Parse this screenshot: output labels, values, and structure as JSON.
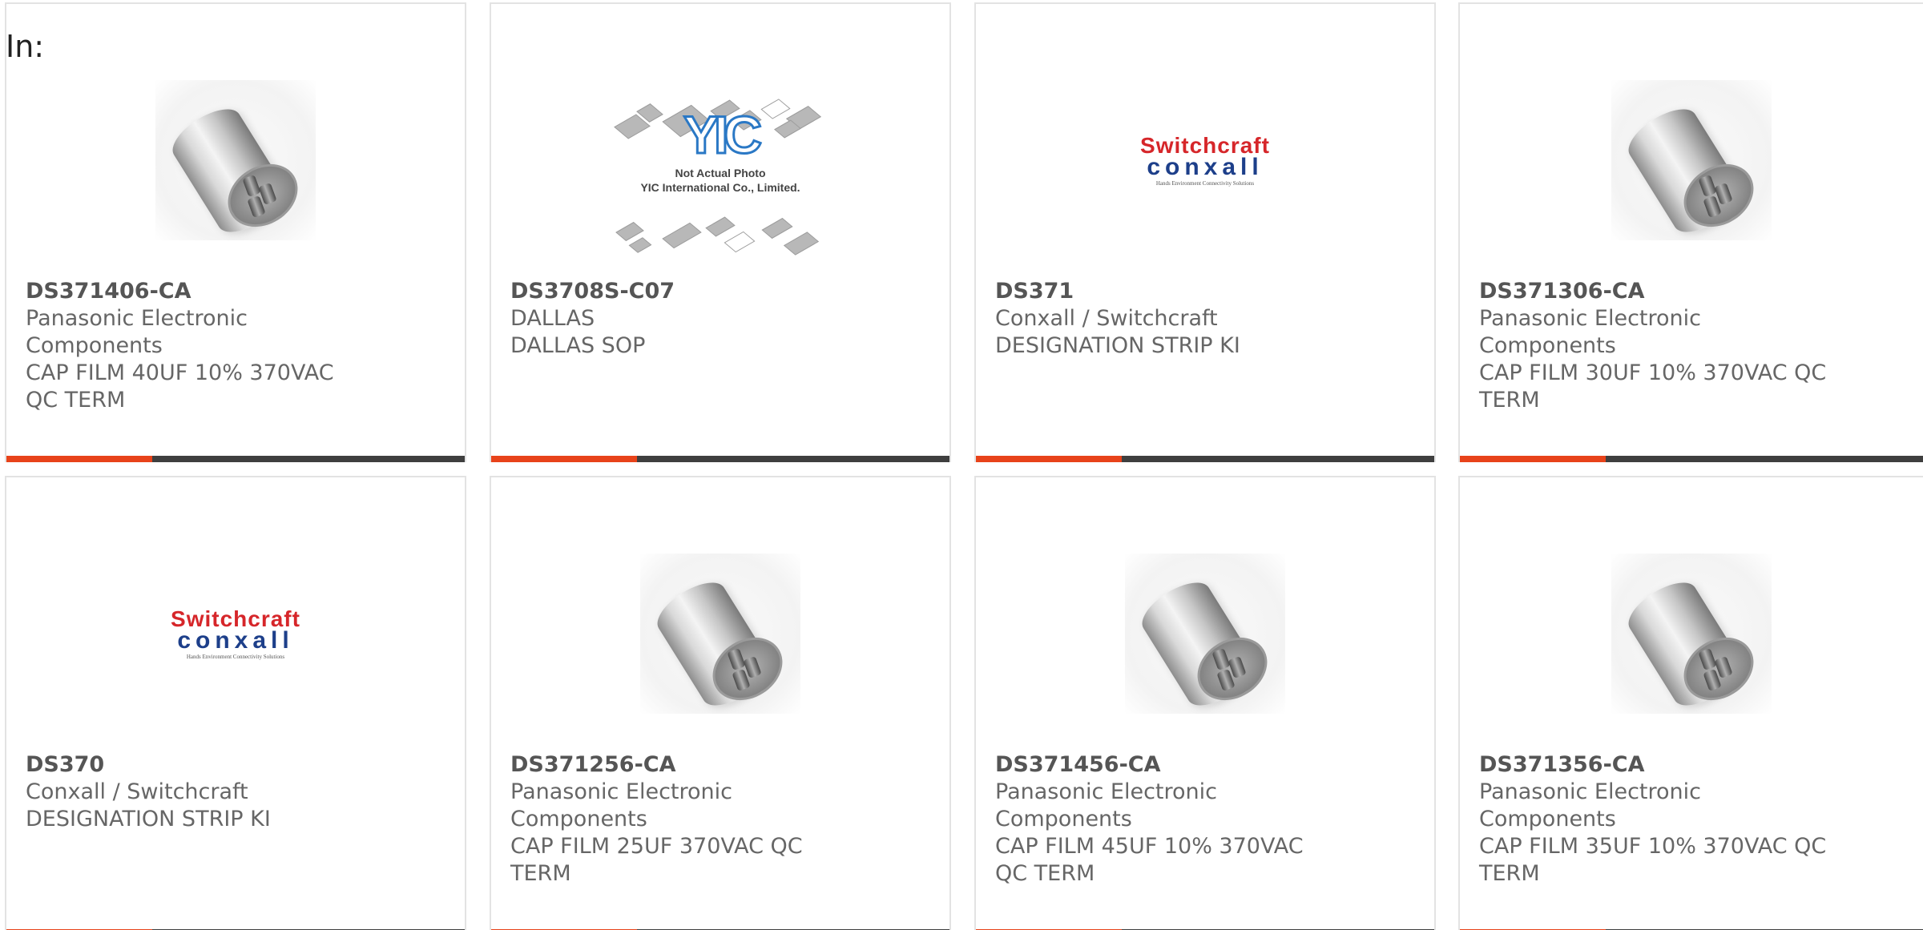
{
  "header": {
    "in_label": "In:"
  },
  "colors": {
    "accent_bar": "#e8431a",
    "dark_bar": "#3f3f3f"
  },
  "products": [
    {
      "part_number": "DS371406-CA",
      "manufacturer": "Panasonic Electronic Components",
      "description": "CAP FILM 40UF 10% 370VAC QC TERM",
      "image": "capacitor-image"
    },
    {
      "part_number": "DS3708S-C07",
      "manufacturer": "DALLAS",
      "description": "DALLAS SOP",
      "image": "yic-placeholder-image",
      "image_caption_line1": "Not Actual Photo",
      "image_caption_line2": "YIC International Co., Limited.",
      "image_logo_text": "YIC"
    },
    {
      "part_number": "DS371",
      "manufacturer": "Conxall / Switchcraft",
      "description": "DESIGNATION STRIP KI",
      "image": "switchcraft-logo-image",
      "logo_line1": "Switchcraft",
      "logo_line2": "conxall",
      "logo_tagline": "Hands Environment Connectivity Solutions"
    },
    {
      "part_number": "DS371306-CA",
      "manufacturer": "Panasonic Electronic Components",
      "description": "CAP FILM 30UF 10% 370VAC QC TERM",
      "image": "capacitor-image"
    },
    {
      "part_number": "DS370",
      "manufacturer": "Conxall / Switchcraft",
      "description": "DESIGNATION STRIP KI",
      "image": "switchcraft-logo-image",
      "logo_line1": "Switchcraft",
      "logo_line2": "conxall",
      "logo_tagline": "Hands Environment Connectivity Solutions"
    },
    {
      "part_number": "DS371256-CA",
      "manufacturer": "Panasonic Electronic Components",
      "description": "CAP FILM 25UF 370VAC QC TERM",
      "image": "capacitor-image"
    },
    {
      "part_number": "DS371456-CA",
      "manufacturer": "Panasonic Electronic Components",
      "description": "CAP FILM 45UF 10% 370VAC QC TERM",
      "image": "capacitor-image"
    },
    {
      "part_number": "DS371356-CA",
      "manufacturer": "Panasonic Electronic Components",
      "description": "CAP FILM 35UF 10% 370VAC QC TERM",
      "image": "capacitor-image"
    }
  ]
}
